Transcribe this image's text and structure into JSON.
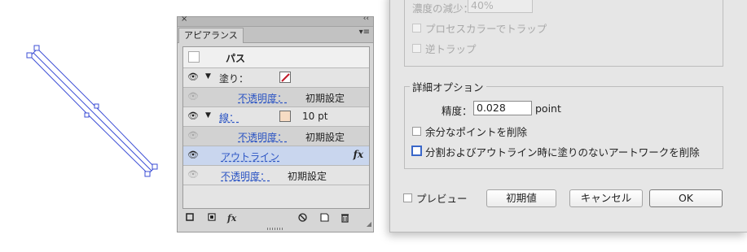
{
  "panel": {
    "close_glyph": "×",
    "collapse_glyph": "‹‹",
    "tab_label": "アピアランス",
    "menu_glyph": "▾≡",
    "rows": {
      "path_label": "パス",
      "fill_label": "塗り：",
      "fill_opacity_label": "不透明度：",
      "fill_opacity_value": "初期設定",
      "stroke_label": "線：",
      "stroke_weight": "10 pt",
      "stroke_opacity_label": "不透明度：",
      "stroke_opacity_value": "初期設定",
      "effect_label": "アウトライン",
      "fx_glyph": "fx",
      "opacity_label": "不透明度：",
      "opacity_value": "初期設定"
    },
    "swatch_colors": {
      "stroke": "#f7dcc4",
      "fill_slash": "#c21d2b"
    },
    "bottom": {
      "fx_glyph": "fx"
    }
  },
  "dialog": {
    "density_label": "濃度の減少：",
    "density_value": "40%",
    "process_trap_label": "プロセスカラーでトラップ",
    "reverse_trap_label": "逆トラップ",
    "detail_group_title": "詳細オプション",
    "precision_label": "精度：",
    "precision_value": "0.028",
    "precision_unit": "point",
    "remove_points_label": "余分なポイントを削除",
    "divide_label": "分割およびアウトライン時に塗りのないアートワークを削除",
    "preview_label": "プレビュー",
    "defaults_button": "初期値",
    "cancel_button": "キャンセル",
    "ok_button": "OK"
  }
}
